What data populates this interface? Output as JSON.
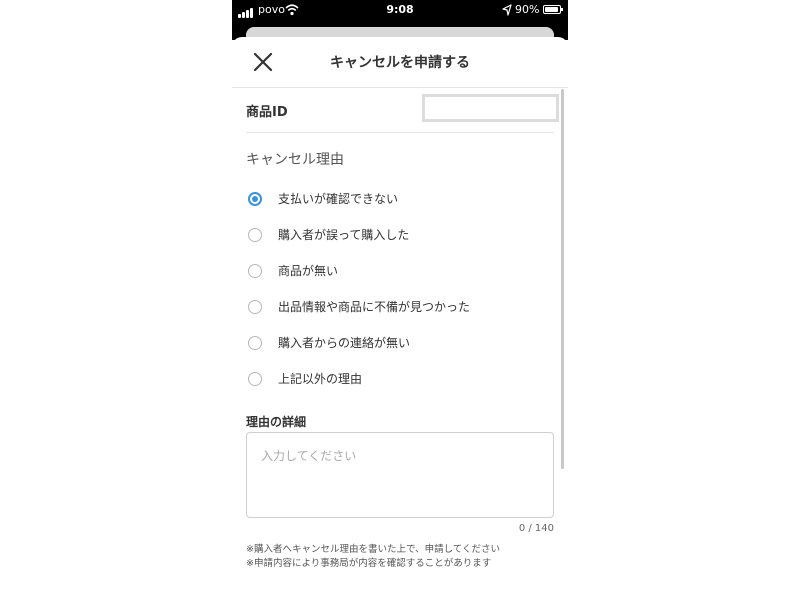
{
  "status_bar": {
    "carrier": "povo",
    "time": "9:08",
    "battery_percent": "90%",
    "icons": [
      "signal-icon",
      "wifi-icon",
      "location-arrow-icon",
      "battery-icon"
    ]
  },
  "header": {
    "title": "キャンセルを申請する",
    "close_icon": "close-icon"
  },
  "product": {
    "label": "商品ID",
    "value": ""
  },
  "reason": {
    "heading": "キャンセル理由",
    "selected_index": 0,
    "options": [
      "支払いが確認できない",
      "購入者が誤って購入した",
      "商品が無い",
      "出品情報や商品に不備が見つかった",
      "購入者からの連絡が無い",
      "上記以外の理由"
    ]
  },
  "detail": {
    "label": "理由の詳細",
    "placeholder": "入力してください",
    "counter": "0 / 140"
  },
  "notes": [
    "※購入者へキャンセル理由を書いた上で、申請してください",
    "※申請内容により事務局が内容を確認することがあります"
  ],
  "colors": {
    "accent": "#3a93d8",
    "text": "#333333",
    "divider": "#e4e4e4"
  }
}
